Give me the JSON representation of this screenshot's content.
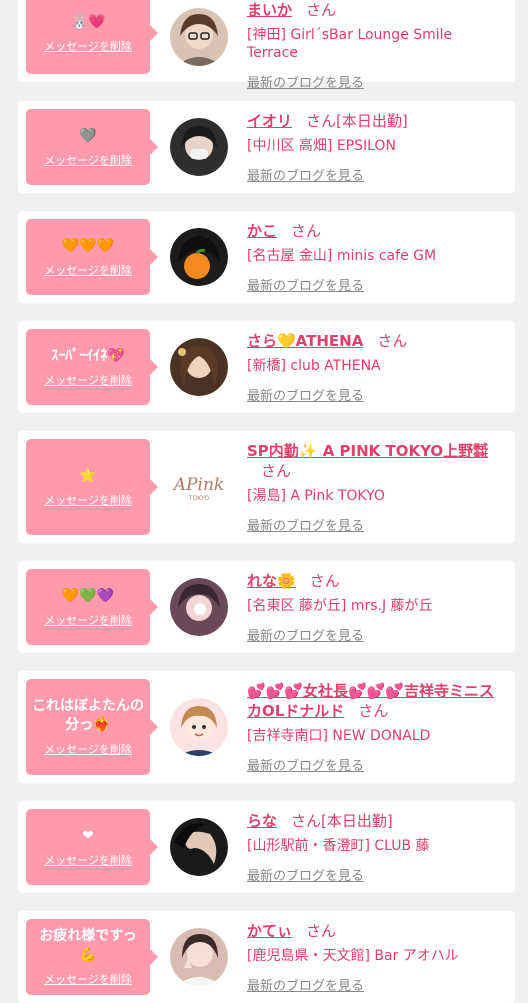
{
  "cards": [
    {
      "message": "🐰💗",
      "delete_label": "メッセージを削除",
      "name": "まいか",
      "honorific": "さん",
      "work": "[神田] Girl´sBar Lounge Smile Terrace",
      "blog_label": "最新のブログを見る",
      "avatar_color": "#6b4c3b"
    },
    {
      "message": "🩶",
      "delete_label": "メッセージを削除",
      "name": "イオリ",
      "honorific": "さん[本日出勤]",
      "work": "[中川区 高畑] EPSILON",
      "blog_label": "最新のブログを見る",
      "avatar_color": "#3a3a3a"
    },
    {
      "message": "🧡🧡🧡",
      "delete_label": "メッセージを削除",
      "name": "かこ",
      "honorific": "さん",
      "work": "[名古屋 金山] minis cafe GM",
      "blog_label": "最新のブログを見る",
      "avatar_color": "#222222"
    },
    {
      "message": "ｽｰﾊﾟｰｲｲﾈ💖",
      "delete_label": "メッセージを削除",
      "name": "さら💛ATHENA",
      "honorific": "さん",
      "work": "[新橋] club ATHENA",
      "blog_label": "最新のブログを見る",
      "avatar_color": "#5a3b2c"
    },
    {
      "message": "⭐",
      "delete_label": "メッセージを削除",
      "name": "SP内勤✨ A PINK TOKYO上野㍿",
      "honorific": "さん",
      "work": "[湯島] A Pink TOKYO",
      "blog_label": "最新のブログを見る",
      "avatar_color": "#ffffff",
      "avatar_logo": "APink",
      "avatar_logo_sub": "TOKYO"
    },
    {
      "message": "🧡💚💜",
      "delete_label": "メッセージを削除",
      "name": "れな🌼",
      "honorific": "さん",
      "work": "[名東区 藤が丘] mrs.J 藤が丘",
      "blog_label": "最新のブログを見る",
      "avatar_color": "#4a3340"
    },
    {
      "message": "これはぼよたんの\n分っ❤️‍🔥",
      "delete_label": "メッセージを削除",
      "name": "💕💕💕女社長💕💕💕吉祥寺ミニスカOLドナルド",
      "honorific": "さん",
      "work": "[吉祥寺南口] NEW DONALD",
      "blog_label": "最新のブログを見る",
      "avatar_color": "#f6dcdc"
    },
    {
      "message": "❤",
      "delete_label": "メッセージを削除",
      "name": "らな",
      "honorific": "さん[本日出勤]",
      "work": "[山形駅前・香澄町] CLUB 藤",
      "blog_label": "最新のブログを見る",
      "avatar_color": "#1e1e1e"
    },
    {
      "message": "お疲れ様ですっ💪",
      "delete_label": "メッセージを削除",
      "name": "かてぃ",
      "honorific": "さん",
      "work": "[鹿児島県・天文館] Bar アオハル",
      "blog_label": "最新のブログを見る",
      "avatar_color": "#c9a9a0"
    }
  ]
}
